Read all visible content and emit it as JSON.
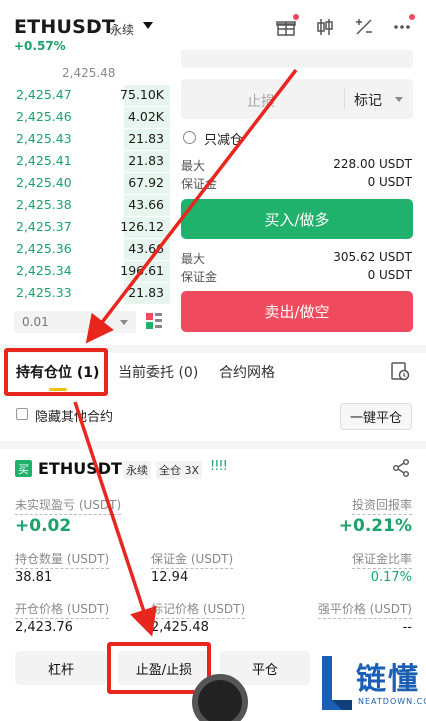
{
  "header": {
    "symbol": "ETHUSDT",
    "perp_label": "永续",
    "change": "+0.57%",
    "icons": [
      "gift-icon",
      "candlestick-icon",
      "calculator-icon",
      "more-icon"
    ]
  },
  "orderbook": {
    "top_price": "2,425.48",
    "rows": [
      {
        "price": "2,425.47",
        "qty": "75.10K"
      },
      {
        "price": "2,425.46",
        "qty": "4.02K"
      },
      {
        "price": "2,425.43",
        "qty": "21.83"
      },
      {
        "price": "2,425.41",
        "qty": "21.83"
      },
      {
        "price": "2,425.40",
        "qty": "67.92"
      },
      {
        "price": "2,425.38",
        "qty": "43.66"
      },
      {
        "price": "2,425.37",
        "qty": "126.12"
      },
      {
        "price": "2,425.36",
        "qty": "43.66"
      },
      {
        "price": "2,425.34",
        "qty": "196.61"
      },
      {
        "price": "2,425.33",
        "qty": "21.83"
      }
    ],
    "precision": "0.01"
  },
  "order_form": {
    "stop_loss_placeholder": "止损",
    "mark_label": "标记",
    "reduce_only": "只减仓",
    "buy_max_label": "最大",
    "buy_max_value": "228.00 USDT",
    "buy_margin_label": "保证金",
    "buy_margin_value": "0 USDT",
    "buy_button": "买入/做多",
    "sell_max_label": "最大",
    "sell_max_value": "305.62 USDT",
    "sell_margin_label": "保证金",
    "sell_margin_value": "0 USDT",
    "sell_button": "卖出/做空"
  },
  "tabs": {
    "positions": "持有仓位 (1)",
    "open_orders": "当前委托 (0)",
    "grid": "合约网格"
  },
  "filters": {
    "hide_other": "隐藏其他合约",
    "close_all": "一键平仓"
  },
  "position": {
    "side_badge": "买",
    "symbol": "ETHUSDT",
    "perp_tag": "永续",
    "cross_tag": "全仓 3X",
    "bars": "!!!!",
    "unrealized_label": "未实现盈亏 (USDT)",
    "unrealized_value": "+0.02",
    "roi_label": "投资回报率",
    "roi_value": "+0.21%",
    "size_label": "持仓数量 (USDT)",
    "size_value": "38.81",
    "margin_label": "保证金 (USDT)",
    "margin_value": "12.94",
    "margin_ratio_label": "保证金比率",
    "margin_ratio_value": "0.17%",
    "entry_label": "开仓价格 (USDT)",
    "entry_value": "2,423.76",
    "mark_label": "标记价格 (USDT)",
    "mark_value": "2,425.48",
    "liq_label": "强平价格 (USDT)",
    "liq_value": "--"
  },
  "actions": {
    "leverage": "杠杆",
    "tpsl": "止盈/止损",
    "close": "平仓"
  },
  "watermark": {
    "brand": "链懂",
    "domain": "NEATDOWN.COM"
  },
  "colors": {
    "green": "#20b26c",
    "red": "#ef4a5d",
    "annotation_red": "#e8261e",
    "tab_underline": "#f0c010"
  }
}
